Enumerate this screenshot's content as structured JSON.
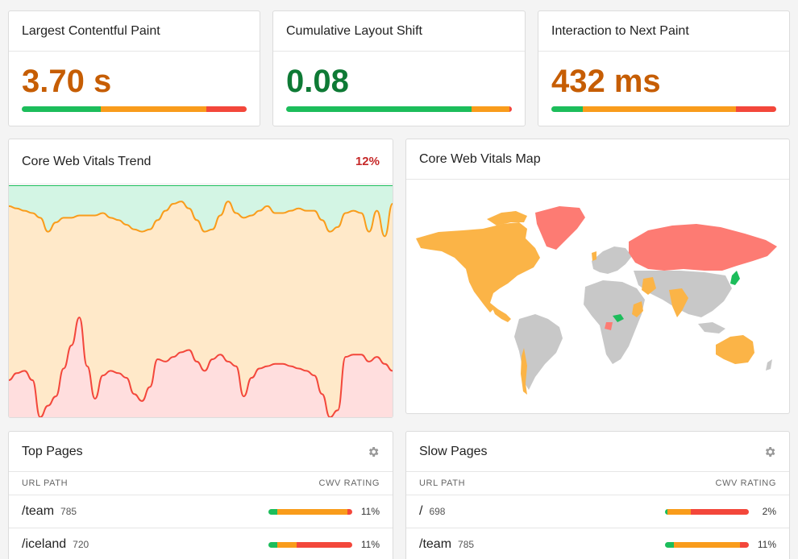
{
  "colors": {
    "good": "#1cbd5b",
    "needs_improvement": "#f99c1b",
    "poor": "#f3473b",
    "orange_text": "#c65d03",
    "green_text": "#0e7a35",
    "red_text": "#c62828"
  },
  "metrics": [
    {
      "title": "Largest Contentful Paint",
      "value": "3.70 s",
      "status": "needs-improvement",
      "distribution": {
        "good": 0.35,
        "needs_improvement": 0.47,
        "poor": 0.18
      }
    },
    {
      "title": "Cumulative Layout Shift",
      "value": "0.08",
      "status": "good",
      "distribution": {
        "good": 0.82,
        "needs_improvement": 0.17,
        "poor": 0.01
      }
    },
    {
      "title": "Interaction to Next Paint",
      "value": "432 ms",
      "status": "needs-improvement",
      "distribution": {
        "good": 0.14,
        "needs_improvement": 0.68,
        "poor": 0.18
      }
    }
  ],
  "trend": {
    "title": "Core Web Vitals Trend",
    "change": "12%",
    "chart_data": {
      "type": "area",
      "series": [
        {
          "fill": "good",
          "values": [
            100,
            100,
            100,
            100,
            100,
            100,
            100,
            100,
            100,
            100,
            100,
            100,
            100,
            100,
            100,
            100,
            100,
            100,
            100,
            100,
            100,
            100,
            100,
            100,
            100,
            100,
            100,
            100,
            100,
            100,
            100,
            100,
            100,
            100,
            100,
            100,
            100,
            100,
            100,
            100,
            100,
            100,
            100,
            100,
            100,
            100,
            100,
            100,
            100,
            100
          ]
        },
        {
          "fill": "needs_improvement",
          "values": [
            91,
            90,
            89,
            88,
            86,
            80,
            84,
            86,
            86,
            87,
            87,
            87,
            88,
            86,
            85,
            83,
            81,
            80,
            81,
            85,
            89,
            92,
            93,
            90,
            85,
            80,
            81,
            87,
            93,
            88,
            86,
            87,
            89,
            91,
            88,
            88,
            89,
            90,
            89,
            89,
            85,
            80,
            82,
            88,
            89,
            88,
            80,
            89,
            78,
            92
          ]
        },
        {
          "fill": "poor",
          "values": [
            16,
            19,
            20,
            16,
            0,
            5,
            9,
            21,
            31,
            43,
            22,
            8,
            18,
            20,
            19,
            17,
            10,
            7,
            13,
            25,
            24,
            26,
            28,
            29,
            24,
            20,
            25,
            27,
            24,
            22,
            9,
            17,
            21,
            22,
            23,
            23,
            22,
            21,
            20,
            18,
            10,
            0,
            3,
            26,
            27,
            27,
            24,
            26,
            23,
            20
          ]
        }
      ],
      "ylim": [
        0,
        100
      ]
    }
  },
  "map": {
    "title": "Core Web Vitals Map",
    "legend": {
      "good": "#1cbd5b",
      "needs_improvement": "#fbb447",
      "poor": "#fd7b73",
      "no_data": "#c8c8c8"
    }
  },
  "top_pages": {
    "title": "Top Pages",
    "col_url": "URL PATH",
    "col_rating": "CWV RATING",
    "rows": [
      {
        "path": "/team",
        "count": "785",
        "pct": "11%",
        "dist": [
          0.11,
          0.83,
          0.06
        ]
      },
      {
        "path": "/iceland",
        "count": "720",
        "pct": "11%",
        "dist": [
          0.11,
          0.23,
          0.66
        ]
      }
    ]
  },
  "slow_pages": {
    "title": "Slow Pages",
    "col_url": "URL PATH",
    "col_rating": "CWV RATING",
    "rows": [
      {
        "path": "/",
        "count": "698",
        "pct": "2%",
        "dist": [
          0.03,
          0.28,
          0.69
        ]
      },
      {
        "path": "/team",
        "count": "785",
        "pct": "11%",
        "dist": [
          0.11,
          0.78,
          0.11
        ]
      }
    ]
  }
}
